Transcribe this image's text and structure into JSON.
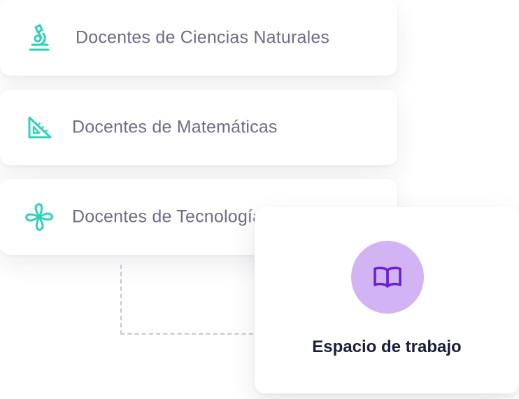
{
  "groups": [
    {
      "label": "Docentes de Ciencias Naturales",
      "icon": "microscope-icon"
    },
    {
      "label": "Docentes de Matemáticas",
      "icon": "set-square-icon"
    },
    {
      "label": "Docentes de Tecnología",
      "icon": "pinwheel-icon"
    }
  ],
  "workspace": {
    "title": "Espacio de trabajo",
    "icon": "book-icon"
  },
  "colors": {
    "icon_accent": "#2ed3b7",
    "label_text": "#6e6c85",
    "workspace_circle": "#d2b4f4",
    "workspace_icon": "#6a1fd0",
    "workspace_title": "#1b1d3a"
  }
}
